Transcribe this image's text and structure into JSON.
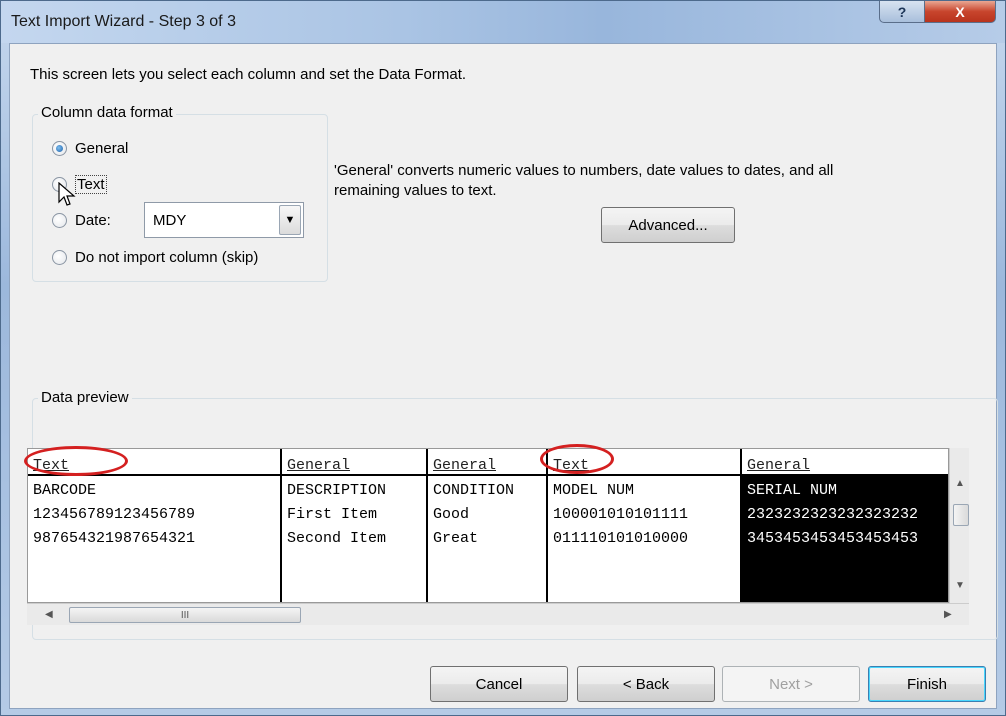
{
  "window": {
    "title": "Text Import Wizard - Step 3 of 3",
    "help": "?",
    "close": "X"
  },
  "intro": "This screen lets you select each column and set the Data Format.",
  "format_group": {
    "label": "Column data format",
    "options": [
      {
        "label": "General",
        "checked": true
      },
      {
        "label": "Text",
        "checked": false
      },
      {
        "label": "Date:",
        "checked": false
      },
      {
        "label": "Do not import column (skip)",
        "checked": false
      }
    ],
    "date_value": "MDY"
  },
  "description": {
    "line1": "'General' converts numeric values to numbers, date values to dates, and all",
    "line2": "remaining values to text."
  },
  "advanced_label": "Advanced...",
  "preview": {
    "label": "Data preview",
    "columns": [
      {
        "format": "Text",
        "rows": [
          "BARCODE",
          "123456789123456789",
          "987654321987654321"
        ]
      },
      {
        "format": "General",
        "rows": [
          "DESCRIPTION",
          "First Item",
          "Second Item"
        ]
      },
      {
        "format": "General",
        "rows": [
          "CONDITION",
          "Good",
          "Great"
        ]
      },
      {
        "format": "Text",
        "rows": [
          "MODEL NUM",
          "100001010101111",
          "011110101010000"
        ]
      },
      {
        "format": "General",
        "rows": [
          "SERIAL NUM",
          "2323232323232323232",
          "3453453453453453453"
        ]
      }
    ],
    "hscroll_grip": "III"
  },
  "buttons": {
    "cancel": "Cancel",
    "back": "< Back",
    "next": "Next >",
    "finish": "Finish"
  },
  "colors": {
    "annotation": "#d42020",
    "title_bar": "#aac4e4"
  }
}
